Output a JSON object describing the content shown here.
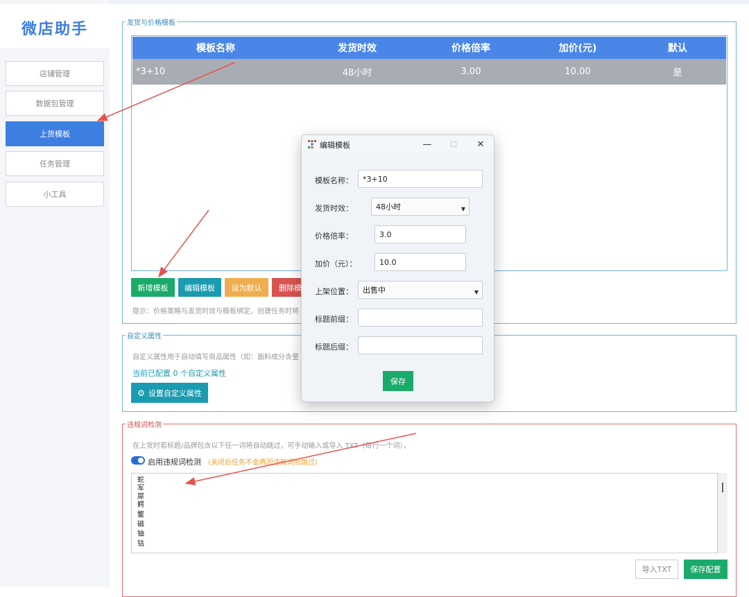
{
  "app": {
    "title": "微店助手"
  },
  "sidebar": {
    "items": [
      {
        "label": "店铺管理",
        "active": false
      },
      {
        "label": "数据包管理",
        "active": false
      },
      {
        "label": "上货模板",
        "active": true
      },
      {
        "label": "任务管理",
        "active": false
      },
      {
        "label": "小工具",
        "active": false
      }
    ]
  },
  "templates_group": {
    "title": "发货与价格模板",
    "columns": [
      "模板名称",
      "发货时效",
      "价格倍率",
      "加价(元)",
      "默认"
    ],
    "rows": [
      [
        "*3+10",
        "48小时",
        "3.00",
        "10.00",
        "是"
      ]
    ],
    "buttons": {
      "add": "新增模板",
      "edit": "编辑模板",
      "set_default": "设为默认",
      "delete": "删除模"
    },
    "hint": "提示：价格策略与发货时效与模板绑定，创建任务时将"
  },
  "custom_attrs_group": {
    "title": "自定义属性",
    "desc": "自定义属性用于自动填写商品属性（如：面料成分含量",
    "count_prefix": "当前已配置",
    "count": "0",
    "count_suffix": "个自定义属性",
    "button": "设置自定义属性"
  },
  "violation_group": {
    "title": "违规词检测",
    "desc": "在上货时若标题/品牌包含以下任一词将自动跳过，可手动输入或导入 TXT（每行一个词）。",
    "toggle_label": "启用违规词检测",
    "toggle_on": true,
    "toggle_note": "(关闭后任务不会再因违规词而跳过)",
    "words": [
      "蛇",
      "军",
      "犀",
      "鳄",
      "鳖",
      "磁",
      "铀",
      "钴"
    ],
    "import_button": "导入TXT",
    "save_button": "保存配置"
  },
  "dialog": {
    "title": "编辑模板",
    "fields": {
      "name_label": "模板名称：",
      "name_value": "*3+10",
      "shipping_label": "发货时效：",
      "shipping_value": "48小时",
      "ratio_label": "价格倍率：",
      "ratio_value": "3.0",
      "markup_label": "加价（元）：",
      "markup_value": "10.0",
      "position_label": "上架位置：",
      "position_value": "出售中",
      "prefix_label": "标题前缀：",
      "prefix_value": "",
      "suffix_label": "标题后缀：",
      "suffix_value": ""
    },
    "save_button": "保存"
  },
  "colors": {
    "accent": "#3d7fe0",
    "table_header": "#4a86e8",
    "selected_row": "#a8adb4",
    "green": "#1aaa6a",
    "teal": "#1a9bb0",
    "orange": "#f0ad4e",
    "red": "#d9534f",
    "annotation_arrow": "#e8534f"
  }
}
